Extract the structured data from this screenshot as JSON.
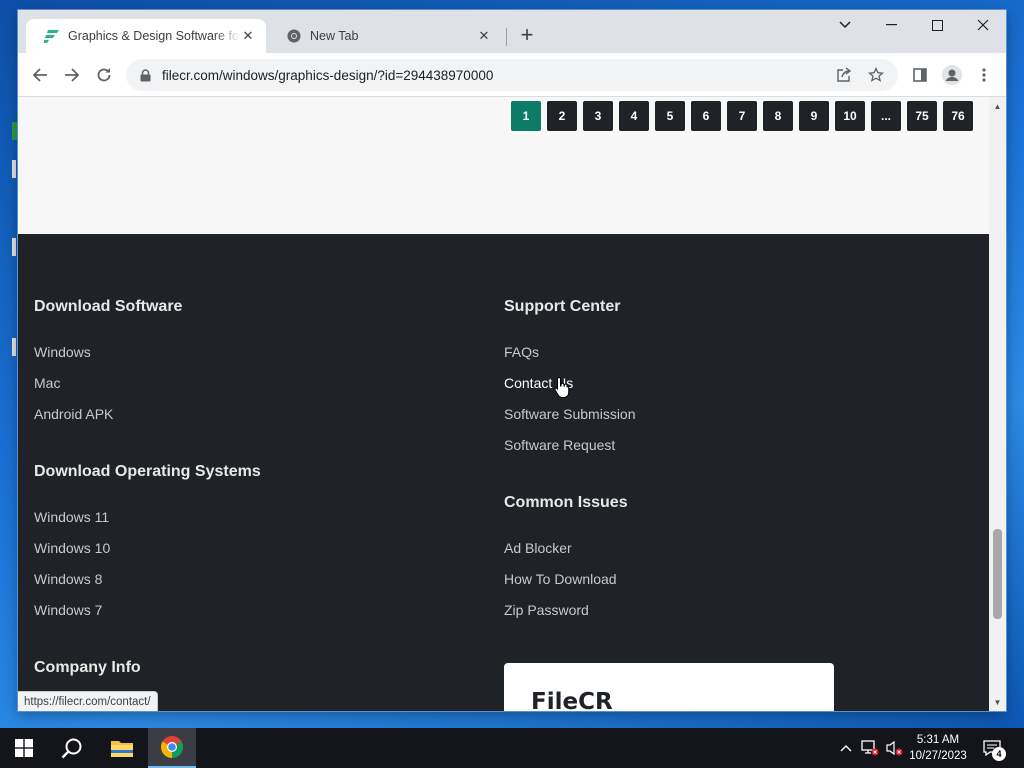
{
  "browser": {
    "tabs": [
      {
        "title": "Graphics & Design Software for Windows",
        "favicon": "filecr-logo-icon",
        "active": true
      },
      {
        "title": "New Tab",
        "favicon": "chrome-icon",
        "active": false
      }
    ],
    "url": "filecr.com/windows/graphics-design/?id=294438970000",
    "status_url": "https://filecr.com/contact/"
  },
  "pagination": [
    "1",
    "2",
    "3",
    "4",
    "5",
    "6",
    "7",
    "8",
    "9",
    "10",
    "...",
    "75",
    "76"
  ],
  "pagination_active": "1",
  "footer": {
    "download_software": {
      "heading": "Download Software",
      "links": [
        "Windows",
        "Mac",
        "Android APK"
      ]
    },
    "download_os": {
      "heading": "Download Operating Systems",
      "links": [
        "Windows 11",
        "Windows 10",
        "Windows 8",
        "Windows 7"
      ]
    },
    "company_info": {
      "heading": "Company Info"
    },
    "support_center": {
      "heading": "Support Center",
      "links": [
        "FAQs",
        "Contact Us",
        "Software Submission",
        "Software Request"
      ]
    },
    "common_issues": {
      "heading": "Common Issues",
      "links": [
        "Ad Blocker",
        "How To Download",
        "Zip Password"
      ]
    },
    "brand": "FileCR"
  },
  "taskbar": {
    "time": "5:31 AM",
    "date": "10/27/2023",
    "notifications": "4"
  },
  "colors": {
    "accent": "#0d7c66",
    "footer_bg": "#1f2226",
    "page_bg": "#f7f7f7"
  }
}
